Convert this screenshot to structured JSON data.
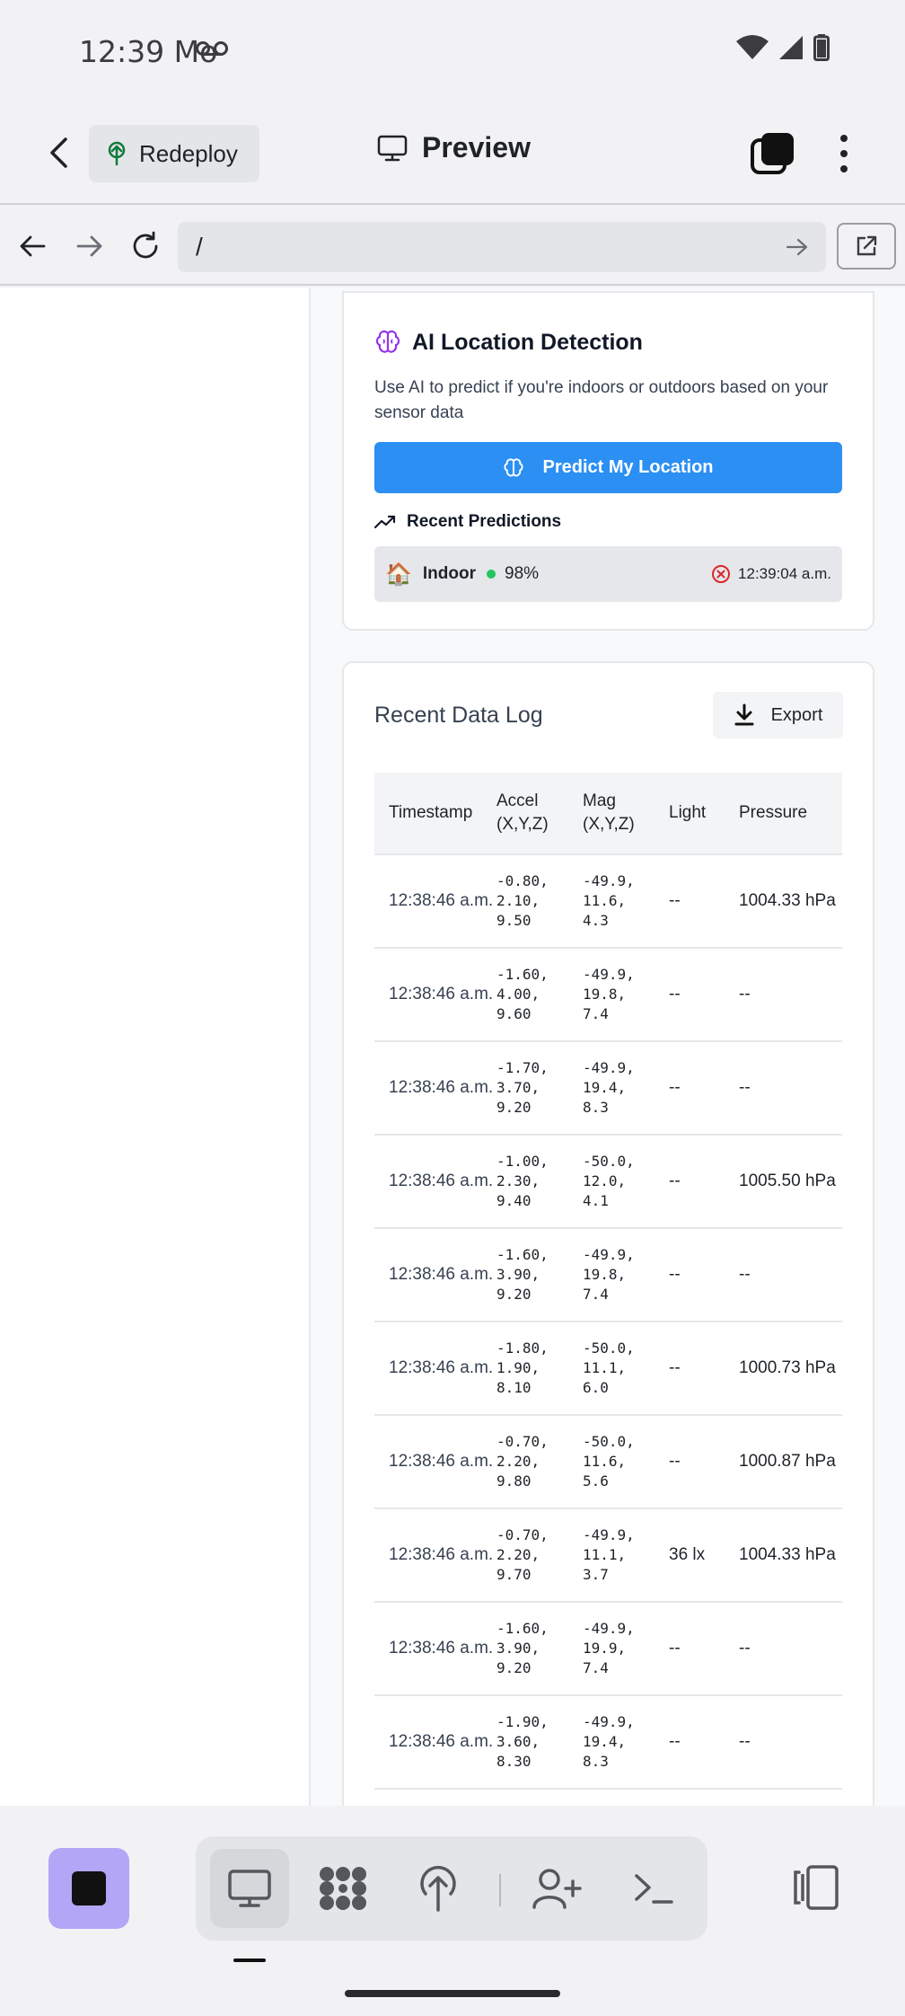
{
  "status_bar": {
    "time": "12:39 Mo"
  },
  "header": {
    "back_icon": "arrow-left-icon",
    "redeploy_label": "Redeploy",
    "title": "Preview"
  },
  "url_bar": {
    "url": "/"
  },
  "ai_card": {
    "title": "AI Location Detection",
    "description": "Use AI to predict if you're indoors or outdoors based on your sensor data",
    "predict_button": "Predict My Location",
    "recent_predictions_label": "Recent Predictions",
    "prediction": {
      "emoji": "🏠",
      "label": "Indoor",
      "confidence": "98%",
      "time": "12:39:04 a.m.",
      "dot_color": "#22c55e"
    }
  },
  "log_card": {
    "title": "Recent Data Log",
    "export_label": "Export",
    "columns": [
      "Timestamp",
      "Accel (X,Y,Z)",
      "Mag (X,Y,Z)",
      "Light",
      "Pressure"
    ],
    "rows": [
      {
        "time": "12:38:46 a.m.",
        "accel": "-0.80,\n2.10,\n9.50",
        "mag": "-49.9,\n11.6,\n4.3",
        "light": "--",
        "pressure": "1004.33 hPa"
      },
      {
        "time": "12:38:46 a.m.",
        "accel": "-1.60,\n4.00,\n9.60",
        "mag": "-49.9,\n19.8,\n7.4",
        "light": "--",
        "pressure": "--"
      },
      {
        "time": "12:38:46 a.m.",
        "accel": "-1.70,\n3.70,\n9.20",
        "mag": "-49.9,\n19.4,\n8.3",
        "light": "--",
        "pressure": "--"
      },
      {
        "time": "12:38:46 a.m.",
        "accel": "-1.00,\n2.30,\n9.40",
        "mag": "-50.0,\n12.0,\n4.1",
        "light": "--",
        "pressure": "1005.50 hPa"
      },
      {
        "time": "12:38:46 a.m.",
        "accel": "-1.60,\n3.90,\n9.20",
        "mag": "-49.9,\n19.8,\n7.4",
        "light": "--",
        "pressure": "--"
      },
      {
        "time": "12:38:46 a.m.",
        "accel": "-1.80,\n1.90,\n8.10",
        "mag": "-50.0,\n11.1,\n6.0",
        "light": "--",
        "pressure": "1000.73 hPa"
      },
      {
        "time": "12:38:46 a.m.",
        "accel": "-0.70,\n2.20,\n9.80",
        "mag": "-50.0,\n11.6,\n5.6",
        "light": "--",
        "pressure": "1000.87 hPa"
      },
      {
        "time": "12:38:46 a.m.",
        "accel": "-0.70,\n2.20,\n9.70",
        "mag": "-49.9,\n11.1,\n3.7",
        "light": "36 lx",
        "pressure": "1004.33 hPa"
      },
      {
        "time": "12:38:46 a.m.",
        "accel": "-1.60,\n3.90,\n9.20",
        "mag": "-49.9,\n19.9,\n7.4",
        "light": "--",
        "pressure": "--"
      },
      {
        "time": "12:38:46 a.m.",
        "accel": "-1.90,\n3.60,\n8.30",
        "mag": "-49.9,\n19.4,\n8.3",
        "light": "--",
        "pressure": "--"
      }
    ]
  },
  "colors": {
    "accent": "#2b8ff3",
    "stop_button": "#b4a6f7"
  }
}
